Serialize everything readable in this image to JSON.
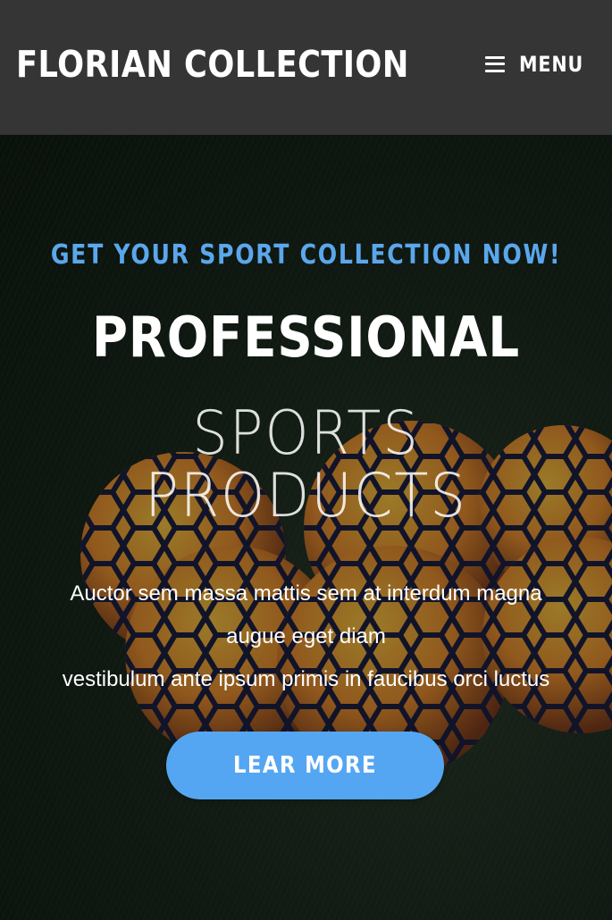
{
  "header": {
    "brand": "FLORIAN COLLECTION",
    "menu_label": "MENU",
    "menu_icon": "hamburger-icon"
  },
  "hero": {
    "kicker": "GET YOUR SPORT COLLECTION NOW!",
    "title_strong": "PROFESSIONAL",
    "title_light_line1": "SPORTS",
    "title_light_line2": "PRODUCTS",
    "description_line1": "Auctor sem massa mattis sem at interdum magna",
    "description_line2": "augue eget diam",
    "description_line3": "vestibulum ante ipsum primis in faucibus orci luctus",
    "cta_label": "LEAR MORE"
  },
  "colors": {
    "header_bg": "#353535",
    "accent": "#55a6f2",
    "kicker": "#5aa7ec",
    "text": "#ffffff"
  }
}
